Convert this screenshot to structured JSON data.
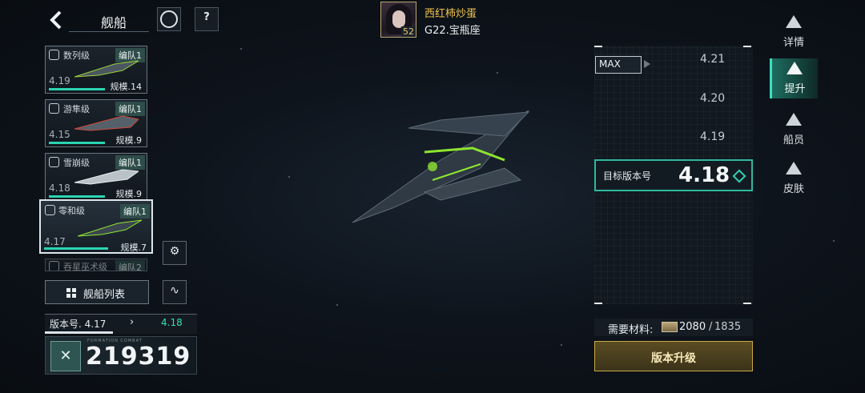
{
  "header": {
    "title": "舰船",
    "back_icon": "chevron-left-icon",
    "btn1_icon": "planet-icon",
    "btn2_icon": "question-icon"
  },
  "player": {
    "name": "西红柿炒蛋",
    "level": "52",
    "server": "G22.宝瓶座"
  },
  "ships": [
    {
      "name": "数列级",
      "tag": "编队1",
      "version": "4.19",
      "scale": "规模.14"
    },
    {
      "name": "游隼级",
      "tag": "编队1",
      "version": "4.15",
      "scale": "规模.9"
    },
    {
      "name": "雪崩级",
      "tag": "编队1",
      "version": "4.18",
      "scale": "规模.9"
    },
    {
      "name": "零和级",
      "tag": "编队1",
      "version": "4.17",
      "scale": "规模.7"
    },
    {
      "name": "吞星巫术级",
      "tag": "编队2"
    }
  ],
  "ship_list_button": "舰船列表",
  "version_row": {
    "current": "版本号. 4.17",
    "arrow": "›",
    "target": "4.18"
  },
  "power": {
    "value": "219319",
    "micro": "FORMATION COMBAT"
  },
  "version_panel": {
    "max_label": "MAX",
    "items": [
      "4.21",
      "4.20",
      "4.19"
    ],
    "target_label": "目标版本号",
    "target_value": "4.18"
  },
  "materials": {
    "label": "需要材料:",
    "have": "2080",
    "separator": "/",
    "need": "1835"
  },
  "upgrade_button": "版本升级",
  "nav": [
    {
      "label": "详情"
    },
    {
      "label": "提升"
    },
    {
      "label": "船员"
    },
    {
      "label": "皮肤"
    }
  ],
  "colors": {
    "accent": "#2fb89e",
    "gold": "#c9a844",
    "name": "#f2c44a"
  }
}
